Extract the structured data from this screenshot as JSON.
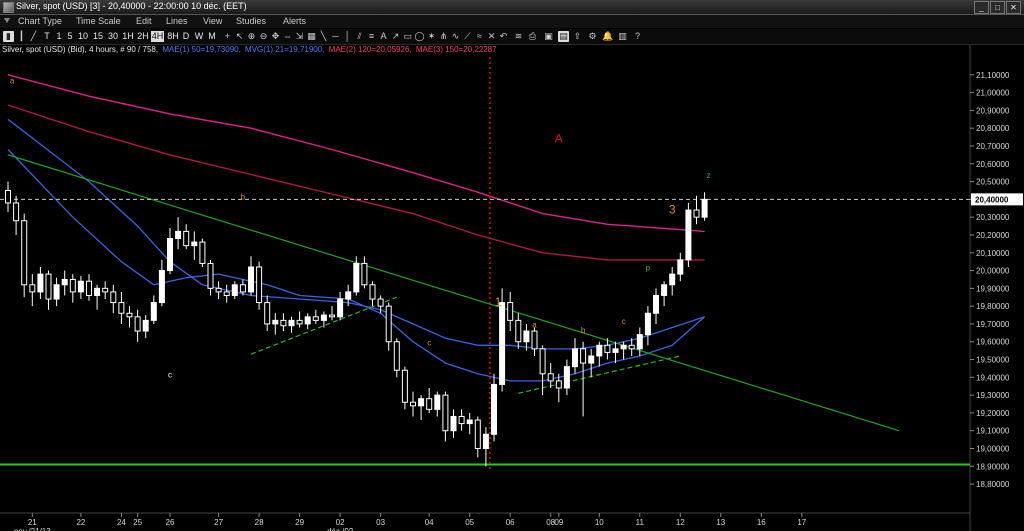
{
  "window": {
    "title": "Silver, spot (USD) [3] - 20,40000 - 22:00:00  10 déc. (EET)",
    "buttons": [
      "_",
      "□",
      "✕"
    ]
  },
  "menu": [
    "Chart Type",
    "Time Scale",
    "Edit",
    "Lines",
    "View",
    "Studies",
    "Alerts"
  ],
  "toolbar": {
    "timeframes": [
      "T",
      "1",
      "5",
      "10",
      "15",
      "30",
      "1H",
      "2H",
      "4H",
      "8H",
      "D",
      "W",
      "M"
    ],
    "active_timeframe": "4H"
  },
  "legend": {
    "instrument": "Silver, spot (USD) (Bid), 4 hours, # 90 / 758,",
    "studies": [
      {
        "text": "MAE(1) 50=19,73090,",
        "color": "#4f7dff"
      },
      {
        "text": "MVG(1) 21=19,71900,",
        "color": "#4f7dff"
      },
      {
        "text": "MAE(2) 120=20,05926,",
        "color": "#ff3b6b"
      },
      {
        "text": "MAE(3) 150=20,22287",
        "color": "#ff3b6b"
      }
    ]
  },
  "colors": {
    "background": "#000000",
    "up_candle": "#ffffff",
    "down_candle": "#ffffff",
    "ma_fast": "#3a64e0",
    "ma_120": "#e0218a",
    "ma_150": "#b01848",
    "trendline": "#1fa51f",
    "support_line": "#22cc22",
    "price_line": "#cccccc",
    "event_line": "#dd1111",
    "wave_orange": "#e0901a",
    "wave_red": "#dd1111",
    "wave_green": "#22bb22"
  },
  "chart_data": {
    "type": "candlestick",
    "ylim": [
      18.75,
      21.2
    ],
    "y_ticks": [
      "21,10000",
      "21,00000",
      "20,90000",
      "20,80000",
      "20,70000",
      "20,60000",
      "20,50000",
      "20,40000",
      "20,30000",
      "20,20000",
      "20,10000",
      "20,00000",
      "19,90000",
      "19,80000",
      "19,70000",
      "19,60000",
      "19,50000",
      "19,40000",
      "19,30000",
      "19,20000",
      "19,10000",
      "19,00000",
      "18,90000",
      "18,80000"
    ],
    "current_price": 20.4,
    "current_price_label": "20,40000",
    "x_ticks": [
      {
        "i": 3,
        "label": "21"
      },
      {
        "i": 9,
        "label": "22"
      },
      {
        "i": 14,
        "label": "24"
      },
      {
        "i": 16,
        "label": "25"
      },
      {
        "i": 20,
        "label": "26"
      },
      {
        "i": 26,
        "label": "27"
      },
      {
        "i": 31,
        "label": "28"
      },
      {
        "i": 36,
        "label": "29"
      },
      {
        "i": 41,
        "label": "02"
      },
      {
        "i": 46,
        "label": "03"
      },
      {
        "i": 52,
        "label": "04"
      },
      {
        "i": 57,
        "label": "05"
      },
      {
        "i": 62,
        "label": "06"
      },
      {
        "i": 67,
        "label": "08"
      },
      {
        "i": 68,
        "label": "09"
      },
      {
        "i": 73,
        "label": "10"
      },
      {
        "i": 78,
        "label": "11"
      },
      {
        "i": 83,
        "label": "12"
      },
      {
        "i": 88,
        "label": "13"
      },
      {
        "i": 93,
        "label": "16"
      },
      {
        "i": 98,
        "label": "17"
      }
    ],
    "x_sub_labels": [
      {
        "i": 3,
        "label": "nov./21/13"
      },
      {
        "i": 41,
        "label": "déc./02"
      }
    ],
    "candles": [
      [
        20.45,
        20.5,
        20.33,
        20.38
      ],
      [
        20.38,
        20.42,
        20.2,
        20.28
      ],
      [
        20.28,
        20.32,
        19.85,
        19.92
      ],
      [
        19.92,
        19.98,
        19.8,
        19.88
      ],
      [
        19.88,
        20.02,
        19.84,
        19.98
      ],
      [
        19.98,
        20.0,
        19.78,
        19.84
      ],
      [
        19.84,
        19.96,
        19.8,
        19.92
      ],
      [
        19.92,
        20.0,
        19.86,
        19.95
      ],
      [
        19.95,
        19.98,
        19.82,
        19.88
      ],
      [
        19.88,
        19.97,
        19.84,
        19.94
      ],
      [
        19.94,
        19.98,
        19.83,
        19.86
      ],
      [
        19.86,
        19.92,
        19.78,
        19.9
      ],
      [
        19.9,
        19.94,
        19.84,
        19.88
      ],
      [
        19.88,
        19.92,
        19.76,
        19.82
      ],
      [
        19.82,
        19.88,
        19.7,
        19.76
      ],
      [
        19.76,
        19.8,
        19.68,
        19.74
      ],
      [
        19.74,
        19.78,
        19.6,
        19.66
      ],
      [
        19.66,
        19.75,
        19.62,
        19.72
      ],
      [
        19.72,
        19.86,
        19.7,
        19.82
      ],
      [
        19.82,
        20.06,
        19.8,
        20.0
      ],
      [
        20.0,
        20.24,
        19.98,
        20.18
      ],
      [
        20.18,
        20.3,
        20.12,
        20.22
      ],
      [
        20.22,
        20.26,
        20.12,
        20.14
      ],
      [
        20.14,
        20.22,
        20.06,
        20.16
      ],
      [
        20.16,
        20.18,
        20.02,
        20.04
      ],
      [
        20.04,
        20.06,
        19.86,
        19.9
      ],
      [
        19.9,
        19.94,
        19.84,
        19.88
      ],
      [
        19.88,
        19.92,
        19.82,
        19.86
      ],
      [
        19.86,
        19.94,
        19.84,
        19.92
      ],
      [
        19.92,
        19.95,
        19.86,
        19.88
      ],
      [
        19.88,
        20.08,
        19.86,
        20.02
      ],
      [
        20.02,
        20.05,
        19.78,
        19.82
      ],
      [
        19.82,
        19.86,
        19.66,
        19.7
      ],
      [
        19.7,
        19.76,
        19.64,
        19.72
      ],
      [
        19.72,
        19.76,
        19.66,
        19.69
      ],
      [
        19.69,
        19.74,
        19.65,
        19.72
      ],
      [
        19.72,
        19.77,
        19.68,
        19.7
      ],
      [
        19.7,
        19.76,
        19.67,
        19.74
      ],
      [
        19.74,
        19.78,
        19.7,
        19.72
      ],
      [
        19.72,
        19.77,
        19.68,
        19.75
      ],
      [
        19.75,
        19.8,
        19.72,
        19.74
      ],
      [
        19.74,
        19.88,
        19.72,
        19.84
      ],
      [
        19.84,
        19.92,
        19.8,
        19.88
      ],
      [
        19.88,
        20.08,
        19.86,
        20.04
      ],
      [
        20.04,
        20.08,
        19.9,
        19.92
      ],
      [
        19.92,
        19.94,
        19.8,
        19.84
      ],
      [
        19.84,
        19.86,
        19.76,
        19.8
      ],
      [
        19.8,
        19.82,
        19.55,
        19.6
      ],
      [
        19.6,
        19.62,
        19.4,
        19.44
      ],
      [
        19.44,
        19.46,
        19.22,
        19.26
      ],
      [
        19.26,
        19.32,
        19.18,
        19.24
      ],
      [
        19.24,
        19.3,
        19.16,
        19.28
      ],
      [
        19.28,
        19.34,
        19.2,
        19.22
      ],
      [
        19.22,
        19.32,
        19.18,
        19.3
      ],
      [
        19.3,
        19.32,
        19.04,
        19.1
      ],
      [
        19.1,
        19.22,
        19.06,
        19.18
      ],
      [
        19.18,
        19.22,
        19.1,
        19.14
      ],
      [
        19.14,
        19.2,
        19.08,
        19.16
      ],
      [
        19.16,
        19.18,
        18.95,
        19.0
      ],
      [
        19.0,
        19.12,
        18.9,
        19.08
      ],
      [
        19.08,
        19.42,
        19.04,
        19.36
      ],
      [
        19.36,
        19.9,
        19.32,
        19.82
      ],
      [
        19.82,
        19.88,
        19.66,
        19.72
      ],
      [
        19.72,
        19.76,
        19.56,
        19.6
      ],
      [
        19.6,
        19.7,
        19.55,
        19.66
      ],
      [
        19.66,
        19.68,
        19.52,
        19.56
      ],
      [
        19.56,
        19.58,
        19.3,
        19.42
      ],
      [
        19.42,
        19.48,
        19.34,
        19.38
      ],
      [
        19.38,
        19.42,
        19.26,
        19.34
      ],
      [
        19.34,
        19.5,
        19.3,
        19.46
      ],
      [
        19.46,
        19.62,
        19.42,
        19.56
      ],
      [
        19.56,
        19.6,
        19.18,
        19.48
      ],
      [
        19.48,
        19.56,
        19.4,
        19.52
      ],
      [
        19.52,
        19.6,
        19.46,
        19.58
      ],
      [
        19.58,
        19.62,
        19.5,
        19.54
      ],
      [
        19.54,
        19.6,
        19.48,
        19.56
      ],
      [
        19.56,
        19.6,
        19.5,
        19.58
      ],
      [
        19.58,
        19.62,
        19.52,
        19.56
      ],
      [
        19.56,
        19.68,
        19.52,
        19.64
      ],
      [
        19.64,
        19.8,
        19.58,
        19.76
      ],
      [
        19.76,
        19.9,
        19.7,
        19.86
      ],
      [
        19.86,
        19.94,
        19.8,
        19.92
      ],
      [
        19.92,
        20.02,
        19.86,
        19.98
      ],
      [
        19.98,
        20.1,
        19.94,
        20.06
      ],
      [
        20.06,
        20.38,
        20.02,
        20.34
      ],
      [
        20.34,
        20.42,
        20.26,
        20.3
      ],
      [
        20.3,
        20.44,
        20.28,
        20.4
      ]
    ],
    "mav_fast": [
      [
        0,
        20.85
      ],
      [
        10,
        20.5
      ],
      [
        16,
        20.25
      ],
      [
        20,
        20.05
      ],
      [
        24,
        19.92
      ],
      [
        30,
        19.86
      ],
      [
        36,
        19.84
      ],
      [
        42,
        19.82
      ],
      [
        46,
        19.78
      ],
      [
        50,
        19.7
      ],
      [
        54,
        19.62
      ],
      [
        58,
        19.58
      ],
      [
        62,
        19.58
      ],
      [
        66,
        19.56
      ],
      [
        70,
        19.56
      ],
      [
        74,
        19.58
      ],
      [
        78,
        19.62
      ],
      [
        82,
        19.68
      ],
      [
        86,
        19.74
      ]
    ],
    "mav_21": [
      [
        0,
        20.68
      ],
      [
        8,
        20.3
      ],
      [
        14,
        20.05
      ],
      [
        18,
        19.92
      ],
      [
        22,
        19.96
      ],
      [
        26,
        19.98
      ],
      [
        32,
        19.92
      ],
      [
        36,
        19.86
      ],
      [
        42,
        19.84
      ],
      [
        46,
        19.76
      ],
      [
        50,
        19.6
      ],
      [
        54,
        19.48
      ],
      [
        58,
        19.42
      ],
      [
        62,
        19.38
      ],
      [
        66,
        19.38
      ],
      [
        70,
        19.42
      ],
      [
        74,
        19.48
      ],
      [
        78,
        19.52
      ],
      [
        82,
        19.58
      ],
      [
        86,
        19.74
      ]
    ],
    "mae_120": [
      [
        0,
        21.1
      ],
      [
        10,
        20.98
      ],
      [
        20,
        20.88
      ],
      [
        30,
        20.8
      ],
      [
        40,
        20.68
      ],
      [
        50,
        20.55
      ],
      [
        58,
        20.44
      ],
      [
        66,
        20.32
      ],
      [
        74,
        20.26
      ],
      [
        80,
        20.24
      ],
      [
        86,
        20.22
      ]
    ],
    "mae_150": [
      [
        0,
        20.93
      ],
      [
        10,
        20.78
      ],
      [
        20,
        20.65
      ],
      [
        30,
        20.54
      ],
      [
        40,
        20.43
      ],
      [
        50,
        20.32
      ],
      [
        58,
        20.2
      ],
      [
        66,
        20.1
      ],
      [
        74,
        20.06
      ],
      [
        80,
        20.06
      ],
      [
        86,
        20.06
      ]
    ],
    "trendlines": [
      {
        "from": [
          0,
          20.65
        ],
        "to": [
          110,
          19.1
        ],
        "color": "trendline"
      },
      {
        "from": [
          30,
          19.53
        ],
        "to": [
          48,
          19.85
        ],
        "color": "wave_green",
        "dashed": true
      },
      {
        "from": [
          63,
          19.31
        ],
        "to": [
          83,
          19.52
        ],
        "color": "wave_green",
        "dashed": true
      }
    ],
    "support": 18.91,
    "event_index": 59.5,
    "annotations": [
      {
        "i": 0.5,
        "y": 21.05,
        "text": "a",
        "color": "wave_orange"
      },
      {
        "i": 29,
        "y": 20.4,
        "text": "b",
        "color": "wave_orange"
      },
      {
        "i": 20,
        "y": 19.4,
        "text": "c",
        "color": "up_candle"
      },
      {
        "i": 52,
        "y": 19.58,
        "text": "c",
        "color": "wave_orange"
      },
      {
        "i": 60.5,
        "y": 19.8,
        "text": "1",
        "color": "wave_orange"
      },
      {
        "i": 68,
        "y": 20.72,
        "text": "A",
        "color": "wave_red"
      },
      {
        "i": 65,
        "y": 19.68,
        "text": "a",
        "color": "wave_orange"
      },
      {
        "i": 71,
        "y": 19.65,
        "text": "b",
        "color": "wave_orange"
      },
      {
        "i": 76,
        "y": 19.7,
        "text": "c",
        "color": "wave_orange"
      },
      {
        "i": 79,
        "y": 20.0,
        "text": "p",
        "color": "wave_green"
      },
      {
        "i": 82,
        "y": 20.32,
        "text": "3",
        "color": "wave_orange"
      },
      {
        "i": 86.5,
        "y": 20.52,
        "text": "z",
        "color": "wave_green"
      }
    ]
  }
}
